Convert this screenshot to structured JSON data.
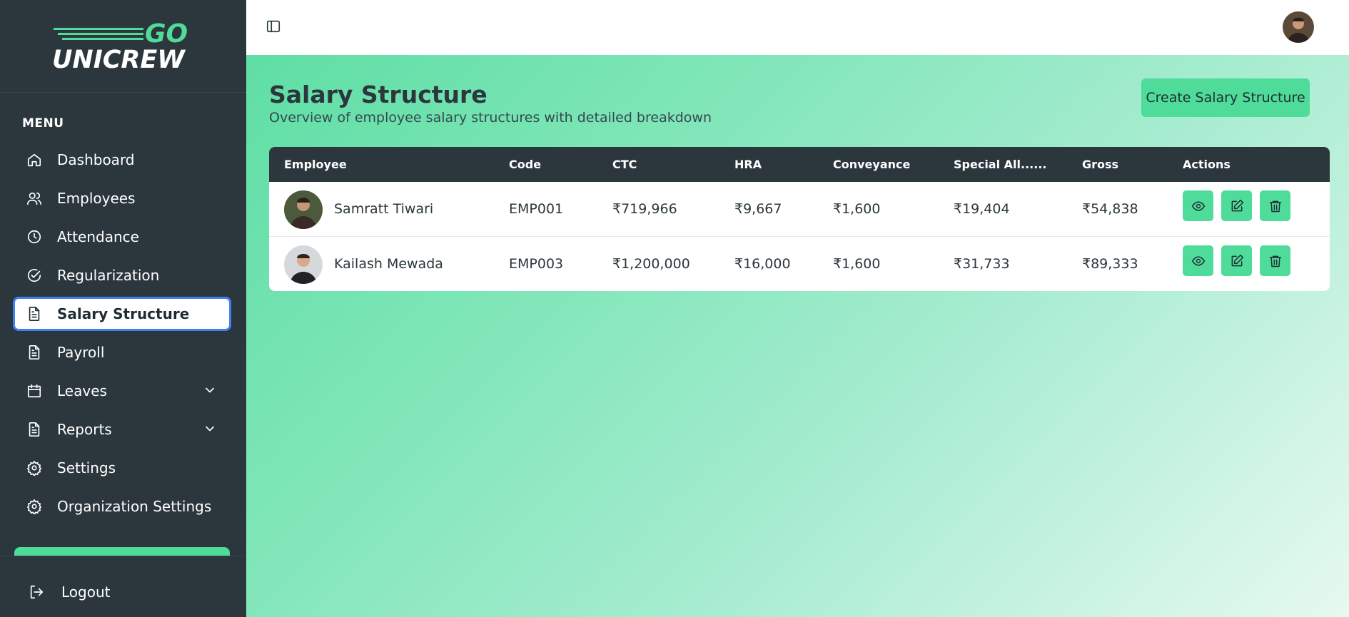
{
  "brand": {
    "logo_top": "GO",
    "logo_bottom": "UNICREW",
    "accent": "#4fdc9a"
  },
  "sidebar": {
    "menu_title": "MENU",
    "items": [
      {
        "label": "Dashboard",
        "icon": "home-icon"
      },
      {
        "label": "Employees",
        "icon": "users-icon"
      },
      {
        "label": "Attendance",
        "icon": "clock-icon"
      },
      {
        "label": "Regularization",
        "icon": "check-circle-icon"
      },
      {
        "label": "Salary Structure",
        "icon": "document-icon",
        "active": true
      },
      {
        "label": "Payroll",
        "icon": "document-icon"
      },
      {
        "label": "Leaves",
        "icon": "calendar-icon",
        "expandable": true
      },
      {
        "label": "Reports",
        "icon": "document-icon",
        "expandable": true
      },
      {
        "label": "Settings",
        "icon": "gear-icon"
      },
      {
        "label": "Organization Settings",
        "icon": "gear-icon"
      }
    ],
    "logout_label": "Logout"
  },
  "page": {
    "title": "Salary Structure",
    "subtitle": "Overview of employee salary structures with detailed breakdown",
    "create_button": "Create Salary Structure"
  },
  "table": {
    "headers": [
      "Employee",
      "Code",
      "CTC",
      "HRA",
      "Conveyance",
      "Special All......",
      "Gross",
      "Actions"
    ],
    "rows": [
      {
        "name": "Samratt Tiwari",
        "code": "EMP001",
        "ctc": "₹719,966",
        "hra": "₹9,667",
        "conveyance": "₹1,600",
        "special": "₹19,404",
        "gross": "₹54,838"
      },
      {
        "name": "Kailash Mewada",
        "code": "EMP003",
        "ctc": "₹1,200,000",
        "hra": "₹16,000",
        "conveyance": "₹1,600",
        "special": "₹31,733",
        "gross": "₹89,333"
      }
    ]
  },
  "colors": {
    "sidebar": "#2b373c",
    "accent": "#4fdc9a",
    "active_border": "#3b82f6"
  }
}
